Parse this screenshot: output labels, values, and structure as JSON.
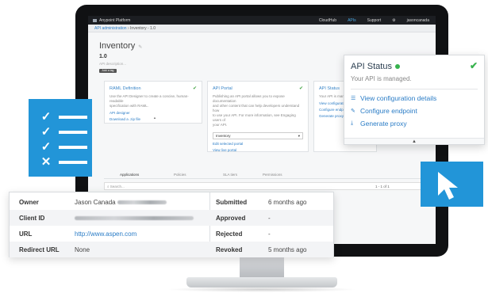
{
  "app": {
    "brand": "Anypoint Platform",
    "nav": [
      "CloudHub",
      "APIs",
      "Support",
      "jasoncanada"
    ],
    "active_nav": "APIs",
    "gear_icon": "gear-icon"
  },
  "breadcrumb": {
    "root": "API administration",
    "current": "Inventory - 1.0"
  },
  "api": {
    "name": "Inventory",
    "version": "1.0",
    "description_placeholder": "API description...",
    "add_tag": "Add a tag"
  },
  "cards": {
    "raml": {
      "title": "RAML Definition",
      "line1": "Use the API Designer to create a concise, human-readable",
      "line2": "specification with RAML.",
      "link1": "API designer",
      "link2": "Download a .zip file"
    },
    "portal": {
      "title": "API Portal",
      "line1": "Publishing an API portal allows you to expose documentation",
      "line2": "and other content that can help developers understand how",
      "line3": "to use your API. For more information, see Engaging users of",
      "line4": "your API.",
      "select": "Inventory",
      "link1": "Edit selected portal",
      "link2": "View live portal"
    },
    "status_small": {
      "title": "API Status",
      "line1": "Your API is managed.",
      "link1": "View configuration details",
      "link2": "Configure endpoint",
      "link3": "Generate proxy"
    }
  },
  "tabs": [
    "Applications",
    "Policies",
    "SLA tiers",
    "Permissions"
  ],
  "search": {
    "placeholder": "Search..."
  },
  "pager": "1 - 1 of 1",
  "api_status_popup": {
    "title": "API Status",
    "message": "Your API is managed.",
    "actions": [
      {
        "label": "View configuration details",
        "icon": "sliders-icon"
      },
      {
        "label": "Configure endpoint",
        "icon": "pencil-icon"
      },
      {
        "label": "Generate proxy",
        "icon": "download-icon"
      }
    ],
    "status_color": "#37b24d"
  },
  "details": {
    "left": [
      {
        "label": "Owner",
        "value": "Jason Canada"
      },
      {
        "label": "Client ID",
        "value": ""
      },
      {
        "label": "URL",
        "value": "http://www.aspen.com"
      },
      {
        "label": "Redirect URL",
        "value": "None"
      }
    ],
    "right": [
      {
        "label": "Submitted",
        "value": "6 months ago"
      },
      {
        "label": "Approved",
        "value": "-"
      },
      {
        "label": "Rejected",
        "value": "-"
      },
      {
        "label": "Revoked",
        "value": "5 months ago"
      }
    ]
  },
  "colors": {
    "accent": "#2295d8",
    "link": "#2a7cc6",
    "success": "#37b24d"
  }
}
